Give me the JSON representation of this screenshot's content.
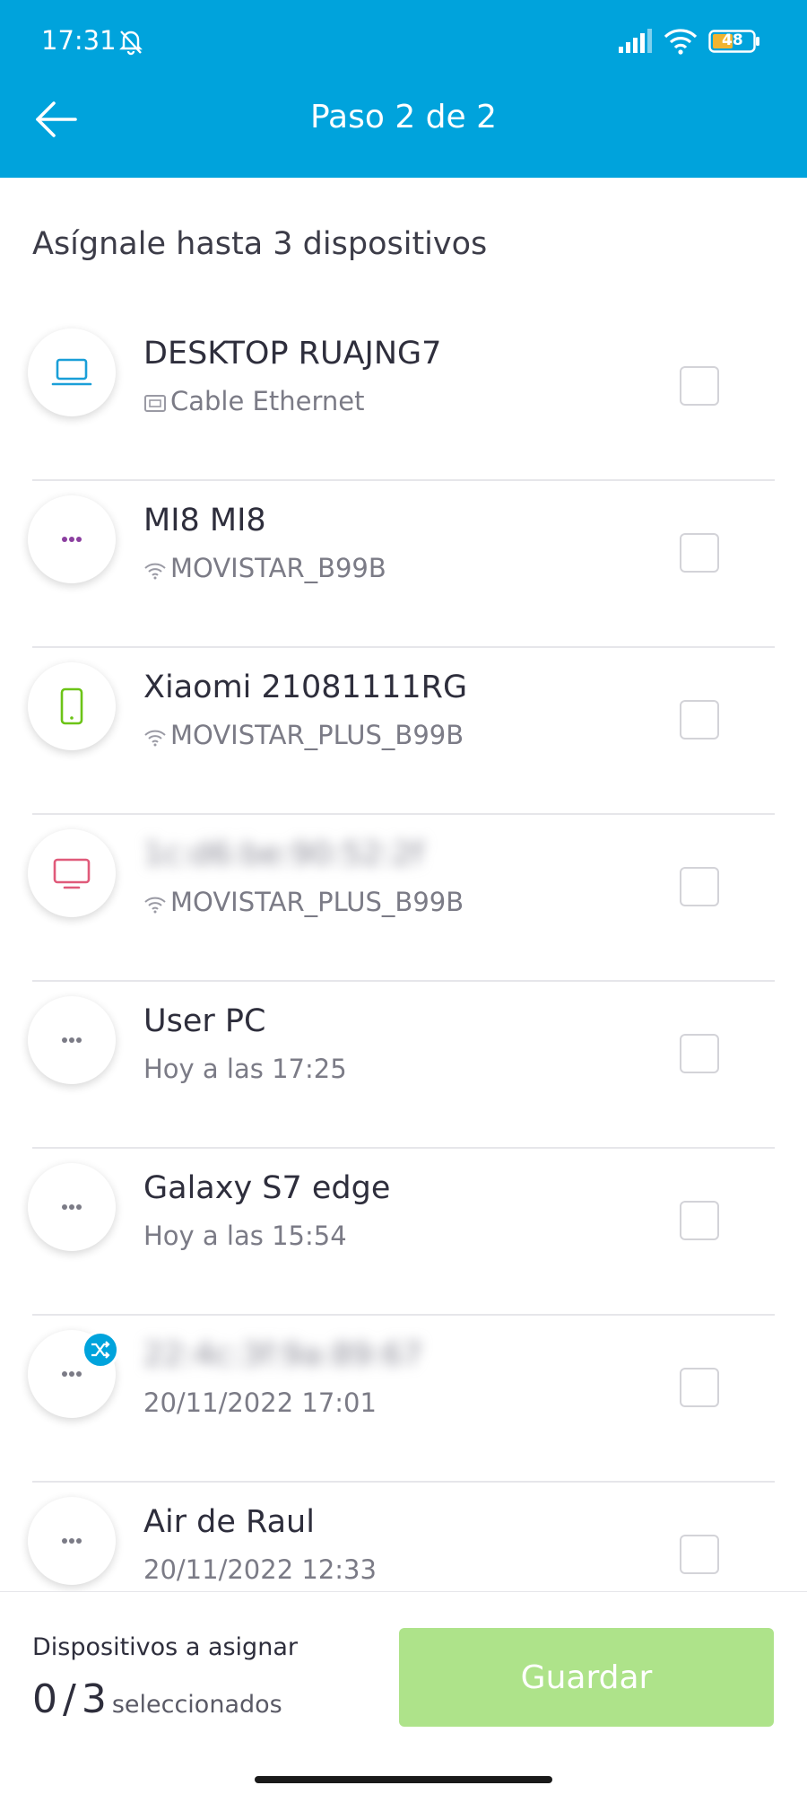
{
  "status_bar": {
    "time": "17:31",
    "battery": "48",
    "icons": [
      "bell-muted-icon",
      "signal-icon",
      "wifi-icon",
      "battery-icon"
    ]
  },
  "header": {
    "title": "Paso 2 de 2",
    "back_icon": "arrow-left-icon"
  },
  "subtitle": "Asígnale hasta 3 dispositivos",
  "devices": [
    {
      "name": "DESKTOP RUAJNG7",
      "subtitle": "Cable Ethernet",
      "icon": "laptop-icon",
      "sub_icon": "ethernet-icon",
      "icon_color": "#1a9fd8",
      "blurred": false
    },
    {
      "name": "MI8 MI8",
      "subtitle": "MOVISTAR_B99B",
      "icon": "more-dots-icon",
      "sub_icon": "wifi-icon",
      "icon_color": "#8b3fa0",
      "blurred": false
    },
    {
      "name": "Xiaomi 21081111RG",
      "subtitle": "MOVISTAR_PLUS_B99B",
      "icon": "smartphone-icon",
      "sub_icon": "wifi-icon",
      "icon_color": "#6cc417",
      "blurred": false
    },
    {
      "name": "1c:d6:be:90:52:2f",
      "subtitle": "MOVISTAR_PLUS_B99B",
      "icon": "tv-icon",
      "sub_icon": "wifi-icon",
      "icon_color": "#e05a7a",
      "blurred": true
    },
    {
      "name": "User PC",
      "subtitle": "Hoy a las 17:25",
      "icon": "more-dots-icon",
      "sub_icon": "",
      "icon_color": "#7b7b86",
      "blurred": false
    },
    {
      "name": "Galaxy S7 edge",
      "subtitle": "Hoy a las 15:54",
      "icon": "more-dots-icon",
      "sub_icon": "",
      "icon_color": "#7b7b86",
      "blurred": false
    },
    {
      "name": "22:4c:3f:9a:89:67",
      "subtitle": "20/11/2022 17:01",
      "icon": "more-dots-icon",
      "sub_icon": "",
      "icon_color": "#7b7b86",
      "blurred": true,
      "badge_icon": "shuffle-icon"
    },
    {
      "name": "Air de Raul",
      "subtitle": "20/11/2022 12:33",
      "icon": "more-dots-icon",
      "sub_icon": "",
      "icon_color": "#7b7b86",
      "blurred": false
    }
  ],
  "footer": {
    "label": "Dispositivos a asignar",
    "selected": "0",
    "separator": "/",
    "max": "3",
    "selected_suffix": "seleccionados",
    "save_label": "Guardar"
  },
  "colors": {
    "brand": "#00a3dc",
    "save_disabled": "#aee38a"
  }
}
